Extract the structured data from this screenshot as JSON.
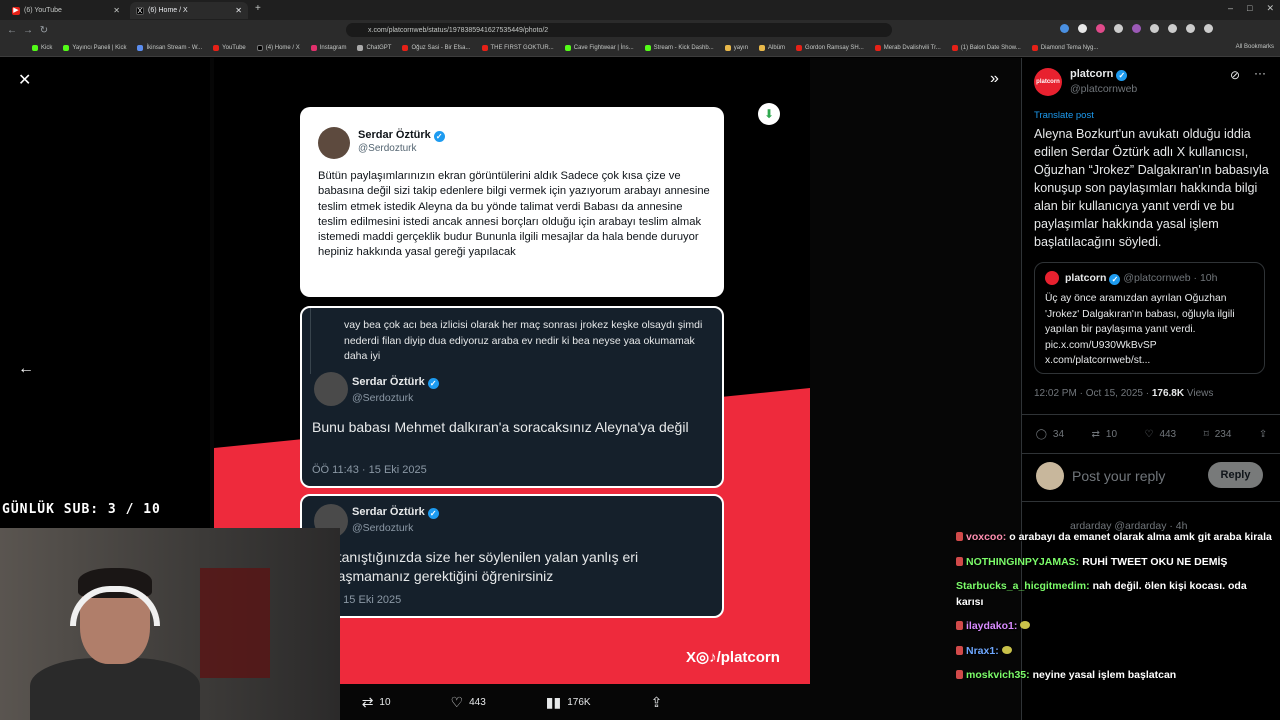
{
  "browser": {
    "tabs": [
      {
        "title": "(6) YouTube",
        "active": false
      },
      {
        "title": "(6) Home / X",
        "active": true
      }
    ],
    "new_tab": "+",
    "url": "x.com/platcornweb/status/1978385941627535449/photo/2",
    "bookmarks": [
      "Kick",
      "Yayıncı Paneli | Kick",
      "İkinsan Stream - W...",
      "YouTube",
      "(4) Home / X",
      "Instagram",
      "ChatGPT",
      "Oğuz Sasi - Bir Efsa...",
      "THE FIRST GOKTUR...",
      "Cave Fightwear | İns...",
      "Stream - Kick Dashb...",
      "yayın",
      "Albüm",
      "Gordon Ramsay SH...",
      "Merab Dvalishvili Tr...",
      "(1) Balon Date Show...",
      "Diamond Tema Nyg..."
    ],
    "all_bookmarks": "All Bookmarks"
  },
  "photo": {
    "card1": {
      "name": "Serdar Öztürk",
      "handle": "@Serdozturk",
      "body": "Bütün paylaşımlarınızın ekran görüntülerini aldık Sadece çok kısa çize ve babasına değil sizi takip edenlere bilgi vermek için yazıyorum arabayı annesine teslim etmek istedik Aleyna da bu yönde talimat verdi Babası da annesine teslim edilmesini istedi ancak annesi borçları olduğu için arabayı teslim almak istemedi maddi gerçeklik budur Bununla ilgili mesajlar da hala bende duruyor hepiniz hakkında yasal gereği yapılacak"
    },
    "card2": {
      "quoted": "vay bea çok acı bea izlicisi olarak her maç sonrası jrokez keşke olsaydı şimdi nederdi filan diyip dua ediyoruz araba ev nedir ki bea neyse yaa okumamak daha iyi",
      "name": "Serdar Öztürk",
      "handle": "@Serdozturk",
      "body": "Bunu babası Mehmet dalkıran'a soracaksınız Aleyna'ya değil",
      "time": "ÖÖ 11:43 · 15 Eki 2025"
    },
    "card3": {
      "name": "Serdar Öztürk",
      "handle": "@Serdozturk",
      "body": "ı ile tanıştığınızda size her söylenilen yalan yanlış eri paylaşmamanız gerektiğini öğrenirsiniz",
      "time": "1:32 · 15 Eki 2025"
    },
    "brand": "X◎♪/platcorn"
  },
  "actions": {
    "retweets": "10",
    "likes": "443",
    "views": "176K"
  },
  "panel": {
    "name": "platcorn",
    "handle": "@platcornweb",
    "translate": "Translate post",
    "text": "Aleyna Bozkurt'un avukatı olduğu iddia edilen Serdar Öztürk adlı X kullanıcısı, Oğuzhan “Jrokez” Dalgakıran'ın babasıyla konuşup son paylaşımları hakkında bilgi alan bir kullanıcıya yanıt verdi ve bu paylaşımlar hakkında yasal işlem başlatılacağını söyledi.",
    "quote": {
      "name": "platcorn",
      "meta": "@platcornweb · 10h",
      "text": "Üç ay önce aramızdan ayrılan Oğuzhan 'Jrokez' Dalgakıran'ın babası, oğluyla ilgili yapılan bir paylaşıma yanıt verdi. pic.x.com/U930WkBvSP x.com/platcornweb/st..."
    },
    "time": "12:02 PM · Oct 15, 2025 · ",
    "views_count": "176.8K",
    "views_label": " Views",
    "stats": {
      "replies": "34",
      "retweets": "10",
      "likes": "443",
      "bookmarks": "234"
    },
    "reply_placeholder": "Post your reply",
    "reply_button": "Reply",
    "next_reply_meta": "ardarday @ardarday · 4h"
  },
  "overlay": {
    "gunluk": "GÜNLÜK SUB: 3 / 10"
  },
  "chat": [
    {
      "user": "voxcoo:",
      "color": "#ff8fb1",
      "msg": "o arabayı da emanet olarak alma amk git araba kirala"
    },
    {
      "user": "NOTHINGINPYJAMAS:",
      "color": "#7cfc6a",
      "msg": "RUHİ TWEET OKU NE DEMİŞ"
    },
    {
      "user": "Starbucks_a_hicgitmedim:",
      "color": "#7cfc6a",
      "msg": "nah değil. ölen kişi kocası. oda karısı"
    },
    {
      "user": "ilaydako1:",
      "color": "#d98cff",
      "msg": ""
    },
    {
      "user": "Nrax1:",
      "color": "#6fa8ff",
      "msg": ""
    },
    {
      "user": "moskvich35:",
      "color": "#7cfc6a",
      "msg": "neyine yasal işlem başlatcan"
    }
  ],
  "colors": {
    "x_blue": "#1d9bf0",
    "brand_red": "#ee2a3c"
  }
}
